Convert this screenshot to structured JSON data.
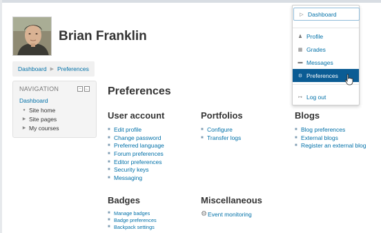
{
  "user": {
    "name": "Brian Franklin"
  },
  "breadcrumb": [
    {
      "label": "Dashboard"
    },
    {
      "label": "Preferences"
    }
  ],
  "navigation": {
    "title": "NAVIGATION",
    "root": "Dashboard",
    "items": [
      {
        "label": "Site home",
        "marker": "bullet"
      },
      {
        "label": "Site pages",
        "marker": "triangle"
      },
      {
        "label": "My courses",
        "marker": "triangle"
      }
    ]
  },
  "main": {
    "title": "Preferences",
    "sections": {
      "user_account": {
        "heading": "User account",
        "links": [
          "Edit profile",
          "Change password",
          "Preferred language",
          "Forum preferences",
          "Editor preferences",
          "Security keys",
          "Messaging"
        ]
      },
      "portfolios": {
        "heading": "Portfolios",
        "links": [
          "Configure",
          "Transfer logs"
        ]
      },
      "blogs": {
        "heading": "Blogs",
        "links": [
          "Blog preferences",
          "External blogs",
          "Register an external blog"
        ]
      },
      "badges": {
        "heading": "Badges",
        "links": [
          "Manage badges",
          "Badge preferences",
          "Backpack settings"
        ]
      },
      "miscellaneous": {
        "heading": "Miscellaneous",
        "links": [
          "Event monitoring"
        ]
      }
    }
  },
  "user_menu": {
    "items": [
      {
        "label": "Dashboard",
        "icon": "dashboard-icon"
      },
      {
        "label": "Profile",
        "icon": "user-icon"
      },
      {
        "label": "Grades",
        "icon": "grades-icon"
      },
      {
        "label": "Messages",
        "icon": "message-icon"
      },
      {
        "label": "Preferences",
        "icon": "wrench-icon",
        "active": true
      },
      {
        "label": "Log out",
        "icon": "logout-icon"
      }
    ]
  },
  "colors": {
    "link": "#0070a8",
    "menu_active": "#0b5c94",
    "text": "#333333"
  }
}
